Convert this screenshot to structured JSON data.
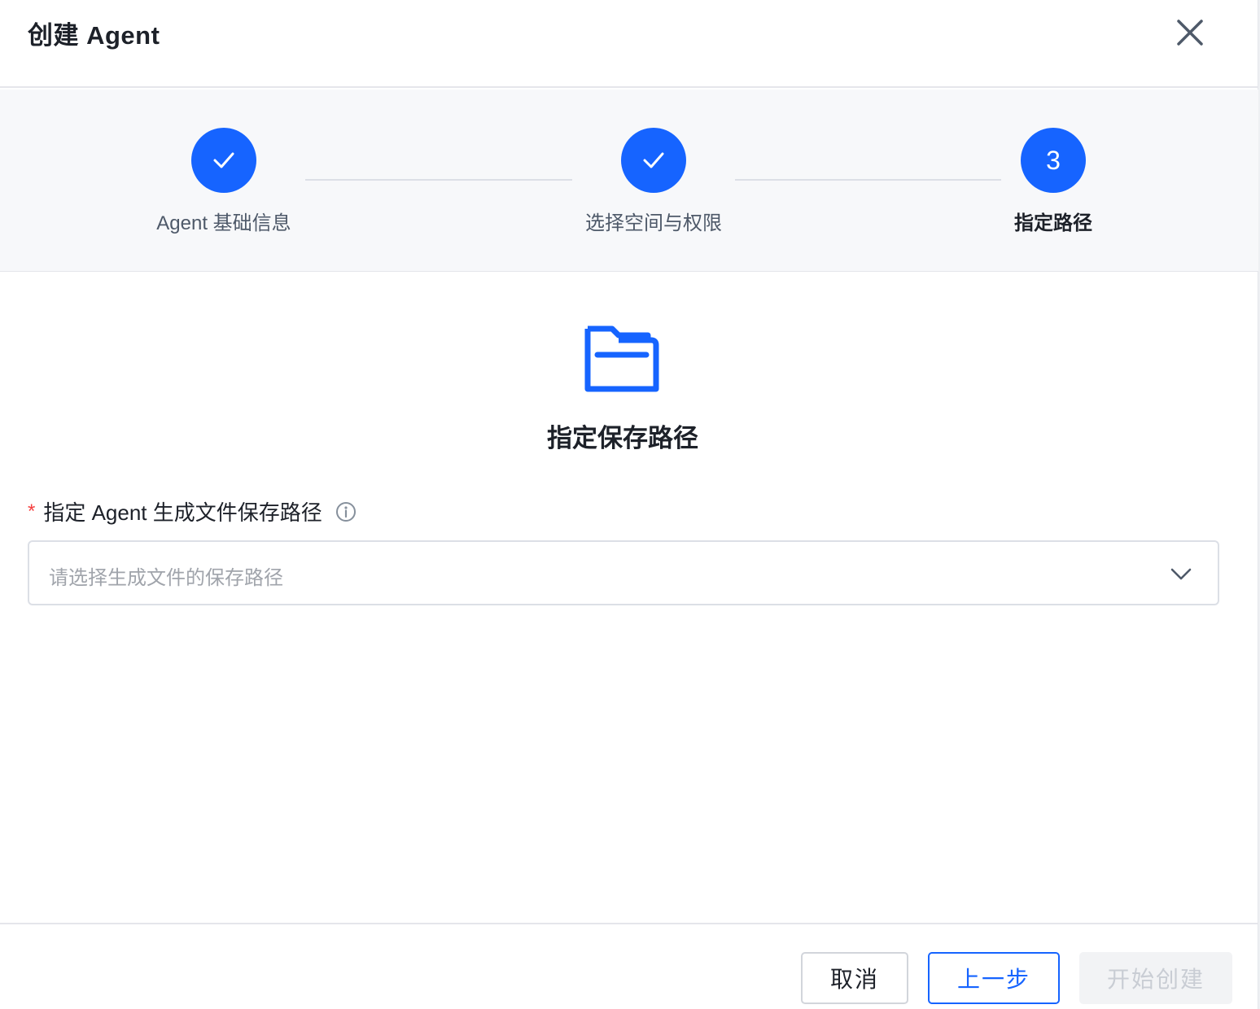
{
  "dialog": {
    "title": "创建 Agent",
    "close_icon": "close-icon"
  },
  "steps": [
    {
      "label": "Agent 基础信息",
      "status": "done",
      "icon": "check-icon"
    },
    {
      "label": "选择空间与权限",
      "status": "done",
      "icon": "check-icon"
    },
    {
      "label": "指定路径",
      "status": "active",
      "number": "3"
    }
  ],
  "content": {
    "icon": "folder-icon",
    "heading": "指定保存路径",
    "field": {
      "required_mark": "*",
      "label": "指定 Agent 生成文件保存路径",
      "info_icon": "info-icon",
      "placeholder": "请选择生成文件的保存路径",
      "value": ""
    }
  },
  "footer": {
    "cancel_label": "取消",
    "prev_label": "上一步",
    "create_label": "开始创建"
  },
  "colors": {
    "primary": "#1664ff",
    "required": "#f53f3f",
    "disabled_text": "#c9cdd4"
  }
}
